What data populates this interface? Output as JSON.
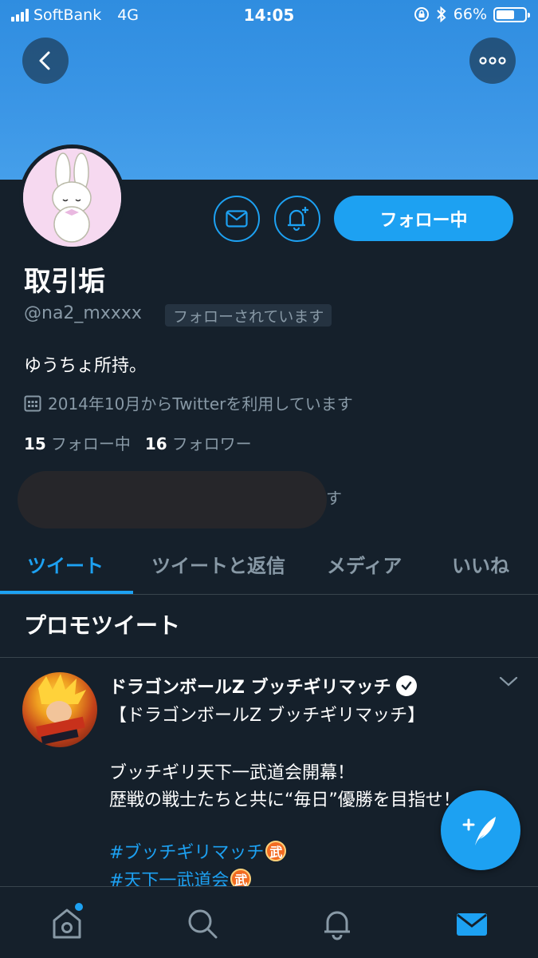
{
  "status_bar": {
    "carrier": "SoftBank",
    "network": "4G",
    "time": "14:05",
    "battery": "66%",
    "battery_level": 0.66
  },
  "header": {
    "back_icon": "back-arrow-icon",
    "more_icon": "more-dots-icon"
  },
  "profile": {
    "name": "取引垢",
    "handle": "@na2_mxxxx",
    "follows_you": "フォローされています",
    "bio": "ゆうちょ所持。",
    "joined": "2014年10月からTwitterを利用しています",
    "following_count": "15",
    "following_label": "フォロー中",
    "followers_count": "16",
    "followers_label": "フォロワー",
    "redacted_tail": "す",
    "follow_button": "フォロー中"
  },
  "tabs": [
    {
      "label": "ツイート",
      "active": true
    },
    {
      "label": "ツイートと返信",
      "active": false
    },
    {
      "label": "メディア",
      "active": false
    },
    {
      "label": "いいね",
      "active": false
    }
  ],
  "section": {
    "title": "プロモツイート"
  },
  "promo_tweet": {
    "author": "ドラゴンボールZ ブッチギリマッチ",
    "lines": [
      "【ドラゴンボールZ ブッチギリマッチ】",
      "ブッチギリ天下一武道会開幕！",
      "歴戦の戦士たちと共に“毎日”優勝を目指せ！"
    ],
    "hashtags": [
      "#ブッチギリマッチ",
      "#天下一武道会"
    ],
    "emoji_char": "武"
  },
  "colors": {
    "accent": "#1da1f2",
    "background": "#15202b",
    "secondary_text": "#8899a6",
    "border": "#38444d"
  }
}
